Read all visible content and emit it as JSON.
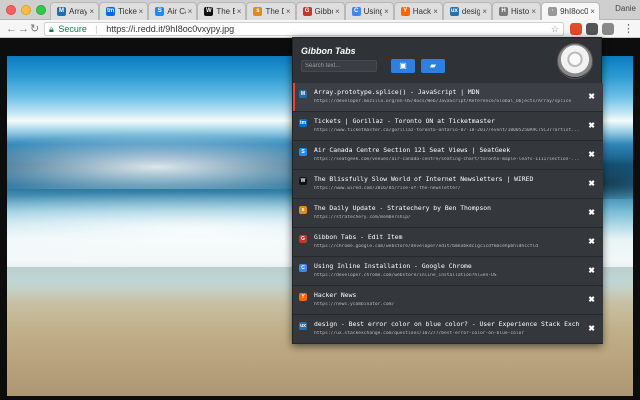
{
  "browser": {
    "tabs": [
      {
        "label": "Array.pr",
        "icon": "mdn-icon",
        "color": "#1e6fb0",
        "glyph": "M"
      },
      {
        "label": "Tickets",
        "icon": "ticketmaster-icon",
        "color": "#026cdf",
        "glyph": "tm"
      },
      {
        "label": "Air Cana",
        "icon": "seatgeek-icon",
        "color": "#1a8cff",
        "glyph": "S"
      },
      {
        "label": "The Blis",
        "icon": "wired-icon",
        "color": "#111111",
        "glyph": "W"
      },
      {
        "label": "The Dai",
        "icon": "stratechery-icon",
        "color": "#e38a1c",
        "glyph": "s"
      },
      {
        "label": "Gibbon",
        "icon": "chrome-store-icon",
        "color": "#c0392b",
        "glyph": "G"
      },
      {
        "label": "Using In",
        "icon": "chrome-icon",
        "color": "#4285f4",
        "glyph": "C"
      },
      {
        "label": "Hacker",
        "icon": "hackernews-icon",
        "color": "#ff6600",
        "glyph": "Y"
      },
      {
        "label": "design",
        "icon": "ux-icon",
        "color": "#2b6fa8",
        "glyph": "ux"
      },
      {
        "label": "History",
        "icon": "history-icon",
        "color": "#7a7a7a",
        "glyph": "H"
      },
      {
        "label": "9hI8oc0",
        "icon": "page-icon",
        "color": "#999999",
        "glyph": "·",
        "active": true
      }
    ],
    "profile_name": "Danie",
    "address": {
      "secure_label": "Secure",
      "url": "https://i.redd.it/9hI8oc0vxypy.jpg"
    }
  },
  "popup": {
    "title": "Gibbon Tabs",
    "search_placeholder": "Search text...",
    "buttons": [
      {
        "icon": "save-window-icon",
        "glyph": "▣"
      },
      {
        "icon": "folder-icon",
        "glyph": "▰"
      }
    ],
    "close_glyph": "✖",
    "rows": [
      {
        "title": "Array.prototype.splice() - JavaScript | MDN",
        "url": "https://developer.mozilla.org/en-US/docs/Web/JavaScript/Reference/Global_Objects/Array/splice",
        "icon": "mdn-icon",
        "color": "#1e6fb0",
        "glyph": "M",
        "active": true
      },
      {
        "title": "Tickets | Gorillaz - Toronto ON at Ticketmaster",
        "url": "https://www.ticketmaster.ca/gorillaz-toronto-ontario-07-18-2017/event/10005250A9C75C37?artist...",
        "icon": "ticketmaster-icon",
        "color": "#026cdf",
        "glyph": "tm"
      },
      {
        "title": "Air Canada Centre Section 121 Seat Views | SeatGeek",
        "url": "https://seatgeek.com/venues/air-canada-centre/seating-chart/toronto-maple-leafs-1111/section-...",
        "icon": "seatgeek-icon",
        "color": "#1a8cff",
        "glyph": "S"
      },
      {
        "title": "The Blissfully Slow World of Internet Newsletters | WIRED",
        "url": "https://www.wired.com/2016/05/rise-of-the-newsletter/",
        "icon": "wired-icon",
        "color": "#111111",
        "glyph": "W"
      },
      {
        "title": "The Daily Update - Stratechery by Ben Thompson",
        "url": "https://stratechery.com/membership/",
        "icon": "stratechery-icon",
        "color": "#e38a1c",
        "glyph": "s"
      },
      {
        "title": "Gibbon Tabs - Edit Item",
        "url": "https://chrome.google.com/webstore/developer/edit/bmkobkdcigcicdfkmcehpbhldhccfld",
        "icon": "chrome-store-icon",
        "color": "#c0392b",
        "glyph": "G"
      },
      {
        "title": "Using Inline Installation - Google Chrome",
        "url": "https://developer.chrome.com/webstore/inline_installation?hl=en-US",
        "icon": "chrome-icon",
        "color": "#4285f4",
        "glyph": "C"
      },
      {
        "title": "Hacker News",
        "url": "https://news.ycombinator.com/",
        "icon": "hackernews-icon",
        "color": "#ff6600",
        "glyph": "Y"
      },
      {
        "title": "design - Best error color on blue color? - User Experience Stack Exchange",
        "url": "https://ux.stackexchange.com/questions/107277/best-error-color-on-blue-color",
        "icon": "ux-icon",
        "color": "#2b6fa8",
        "glyph": "ux"
      }
    ]
  }
}
